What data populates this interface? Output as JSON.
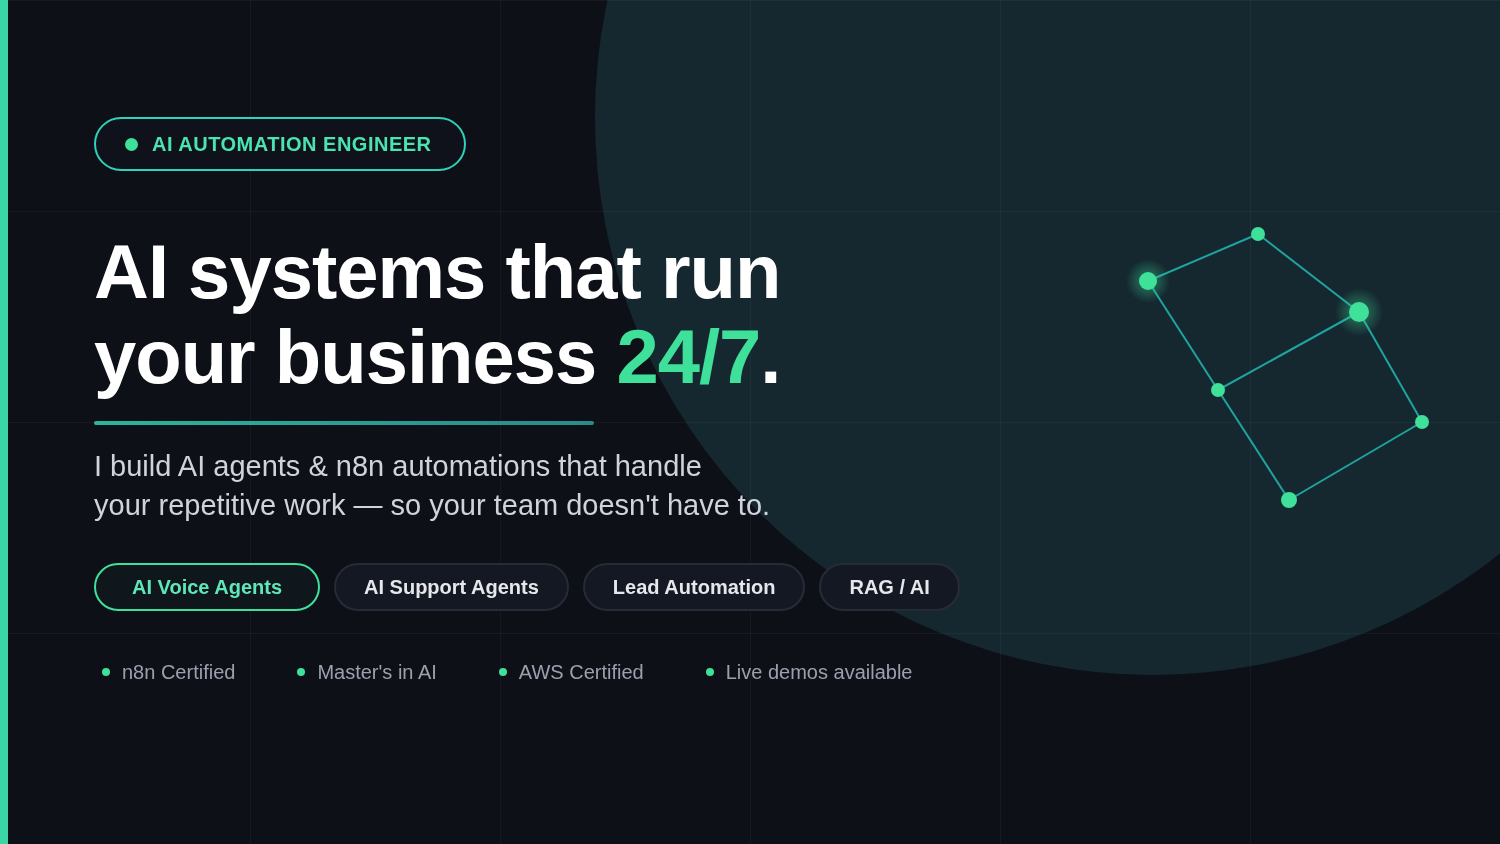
{
  "badge": {
    "label": "AI AUTOMATION ENGINEER"
  },
  "headline": {
    "line_1": "AI systems that run",
    "line_2": "your business",
    "highlight": "24/7",
    "ending": "."
  },
  "subtitle": {
    "line_1": "I build AI agents & n8n automations that handle",
    "line_2": "your repetitive work — so your team doesn't have to."
  },
  "tabs": [
    {
      "label": "AI Voice Agents",
      "selected": true
    },
    {
      "label": "AI Support Agents",
      "selected": false
    },
    {
      "label": "Lead Automation",
      "selected": false
    },
    {
      "label": "RAG / AI",
      "selected": false
    }
  ],
  "credentials": [
    {
      "label": "n8n Certified"
    },
    {
      "label": "Master's in AI"
    },
    {
      "label": "AWS Certified"
    },
    {
      "label": "Live demos available"
    }
  ]
}
